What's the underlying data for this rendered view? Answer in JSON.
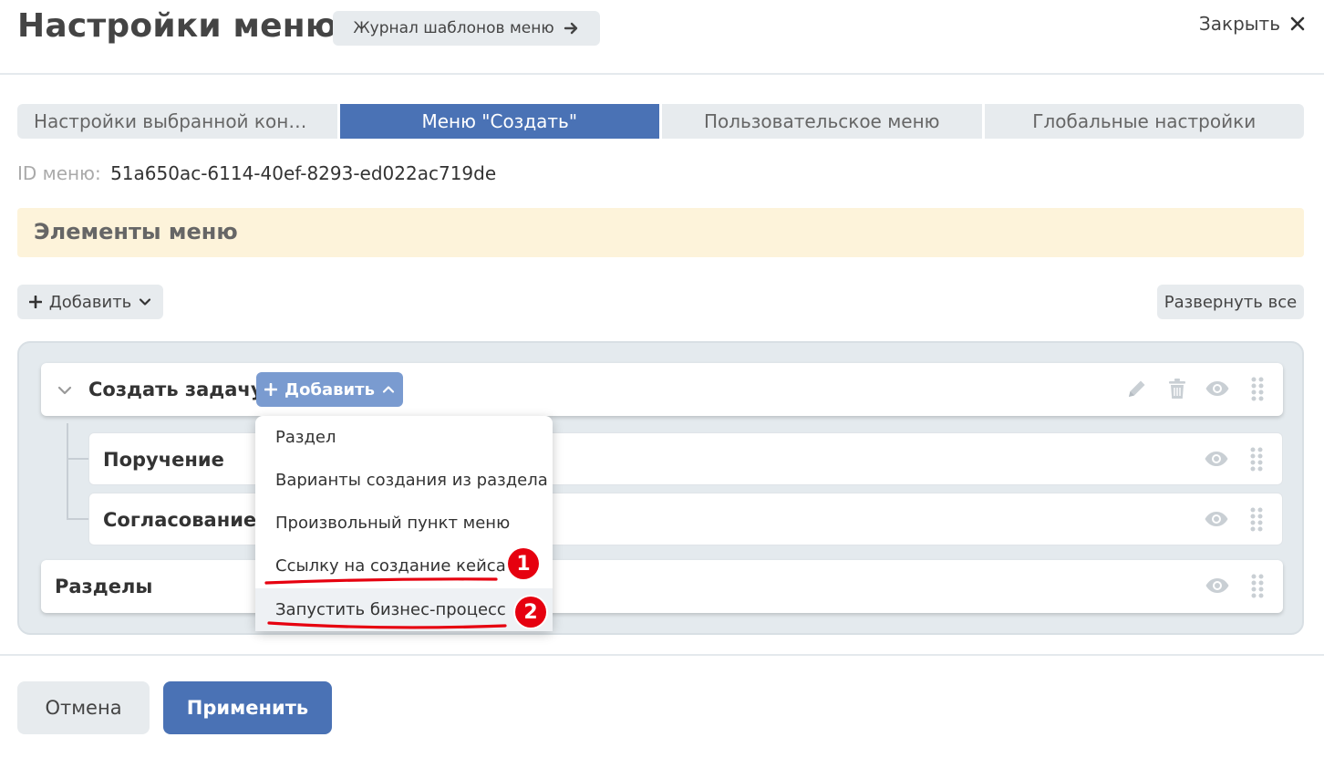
{
  "header": {
    "title": "Настройки меню",
    "journal_button": "Журнал шаблонов меню",
    "close_label": "Закрыть"
  },
  "tabs": [
    {
      "label": "Настройки выбранной конфигурации",
      "active": false
    },
    {
      "label": "Меню \"Создать\"",
      "active": true
    },
    {
      "label": "Пользовательское меню",
      "active": false
    },
    {
      "label": "Глобальные настройки",
      "active": false
    }
  ],
  "menu_id": {
    "label": "ID меню:",
    "value": "51a650ac-6114-40ef-8293-ed022ac719de"
  },
  "section": {
    "title": "Элементы меню"
  },
  "toolbar": {
    "add_label": "Добавить",
    "expand_all_label": "Развернуть все"
  },
  "tree": {
    "main_item": {
      "label": "Создать задачу",
      "add_label": "Добавить"
    },
    "children": [
      {
        "label": "Поручение"
      },
      {
        "label": "Согласование"
      }
    ],
    "sections_item": {
      "label": "Разделы"
    }
  },
  "dropdown": {
    "items": [
      "Раздел",
      "Варианты создания из раздела",
      "Произвольный пункт меню",
      "Ссылку на создание кейса",
      "Запустить бизнес-процесс"
    ],
    "hovered_index": 4
  },
  "annotations": {
    "badge_1": "1",
    "badge_2": "2",
    "color": "#e6000f"
  },
  "footer": {
    "cancel_label": "Отмена",
    "apply_label": "Применить"
  },
  "colors": {
    "primary": "#4a72b5",
    "primary_light": "#7a9bd0",
    "section_bg": "#fdf3da",
    "neutral_button": "#e7ebee"
  }
}
